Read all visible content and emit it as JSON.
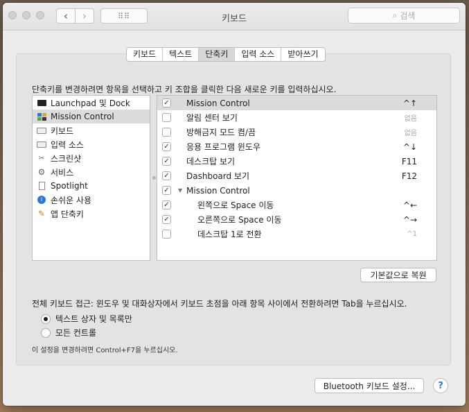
{
  "window": {
    "title": "키보드",
    "search_placeholder": "검색"
  },
  "tabs": [
    {
      "label": "키보드"
    },
    {
      "label": "텍스트"
    },
    {
      "label": "단축키",
      "active": true
    },
    {
      "label": "입력 소스"
    },
    {
      "label": "받아쓰기"
    }
  ],
  "instruction": "단축키를 변경하려면 항목을 선택하고 키 조합을 클릭한 다음 새로운 키를 입력하십시오.",
  "categories": [
    {
      "label": "Launchpad 및 Dock",
      "icon": "launchpad-dock-icon"
    },
    {
      "label": "Mission Control",
      "icon": "mission-control-icon",
      "selected": true
    },
    {
      "label": "키보드",
      "icon": "keyboard-icon"
    },
    {
      "label": "입력 소스",
      "icon": "input-source-icon"
    },
    {
      "label": "스크린샷",
      "icon": "screenshot-icon"
    },
    {
      "label": "서비스",
      "icon": "services-gear-icon"
    },
    {
      "label": "Spotlight",
      "icon": "spotlight-icon"
    },
    {
      "label": "손쉬운 사용",
      "icon": "accessibility-icon"
    },
    {
      "label": "앱 단축키",
      "icon": "app-shortcuts-icon"
    }
  ],
  "shortcuts": [
    {
      "label": "Mission Control",
      "checked": true,
      "key": "^↑",
      "selected": true
    },
    {
      "label": "알림 센터 보기",
      "checked": false,
      "key": "없음",
      "dim": true
    },
    {
      "label": "방해금지 모드 켬/끔",
      "checked": false,
      "key": "없음",
      "dim": true
    },
    {
      "label": "응용 프로그램 윈도우",
      "checked": true,
      "key": "^↓"
    },
    {
      "label": "데스크탑 보기",
      "checked": true,
      "key": "F11"
    },
    {
      "label": "Dashboard 보기",
      "checked": true,
      "key": "F12"
    },
    {
      "label": "Mission Control",
      "checked": true,
      "key": "",
      "group": true
    },
    {
      "label": "왼쪽으로 Space 이동",
      "checked": true,
      "key": "^←",
      "indent": true
    },
    {
      "label": "오른쪽으로 Space 이동",
      "checked": true,
      "key": "^→",
      "indent": true
    },
    {
      "label": "데스크탑 1로 전환",
      "checked": false,
      "key": "^1",
      "indent": true,
      "dim": true
    }
  ],
  "buttons": {
    "restore_defaults": "기본값으로 복원",
    "bluetooth": "Bluetooth 키보드 설정...",
    "help": "?"
  },
  "keyboard_access": {
    "title": "전체 키보드 접근: 윈도우 및 대화상자에서 키보드 초점을 아래 항목 사이에서 전환하려면 Tab을 누르십시오.",
    "options": [
      {
        "label": "텍스트 상자 및 목록만",
        "selected": true
      },
      {
        "label": "모든 컨트롤",
        "selected": false
      }
    ],
    "footnote": "이 설정을 변경하려면 Control+F7을 누르십시오."
  },
  "colors": {
    "selection": "#dcdcdc",
    "window_bg": "#ececec",
    "help_accent": "#2b7bd3"
  }
}
